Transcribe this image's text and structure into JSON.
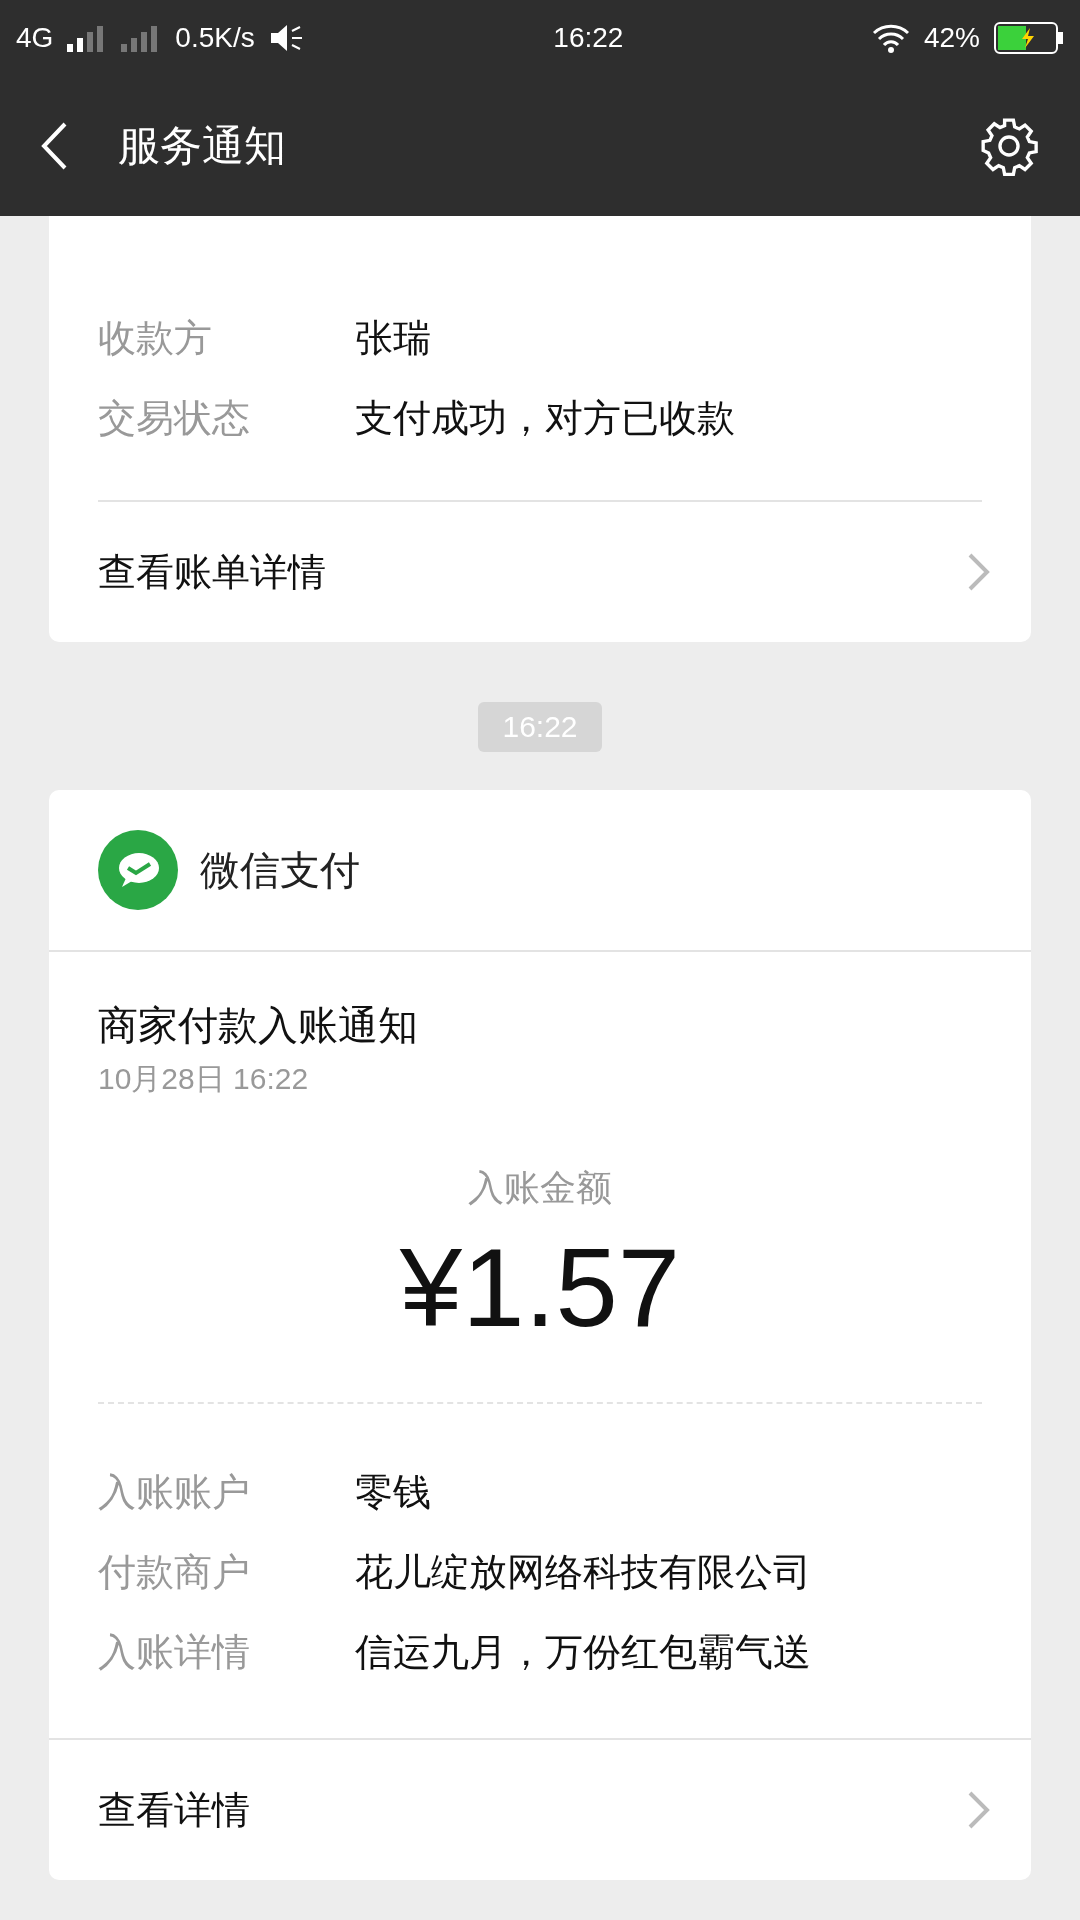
{
  "status_bar": {
    "network": "4G",
    "speed": "0.5K/s",
    "time": "16:22",
    "battery": "42%"
  },
  "header": {
    "title": "服务通知"
  },
  "cards": [
    {
      "kind": "receipt",
      "fields": [
        {
          "label": "收款方",
          "value": "张瑞"
        },
        {
          "label": "交易状态",
          "value": "支付成功，对方已收款"
        }
      ],
      "link": "查看账单详情"
    },
    {
      "kind": "notice",
      "time": "16:22",
      "source": "微信支付",
      "title": "商家付款入账通知",
      "date": "10月28日  16:22",
      "amount_label": "入账金额",
      "amount": "¥1.57",
      "fields": [
        {
          "label": "入账账户",
          "value": "零钱"
        },
        {
          "label": "付款商户",
          "value": "花儿绽放网络科技有限公司"
        },
        {
          "label": "入账详情",
          "value": "信运九月，万份红包霸气送"
        }
      ],
      "link": "查看详情"
    }
  ]
}
